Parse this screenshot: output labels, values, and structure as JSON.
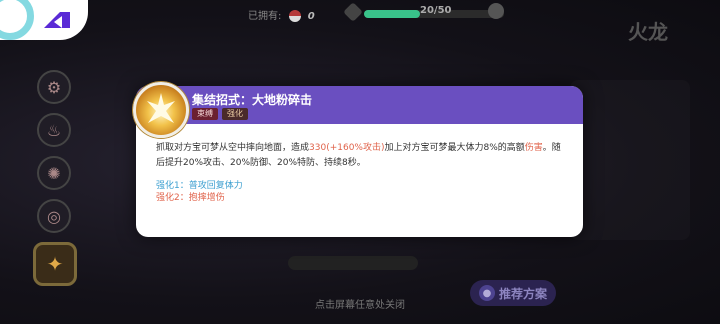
{
  "topbar": {
    "owned_label": "已拥有:",
    "owned_count": "0",
    "xp_text": "20/50",
    "xp_progress": 0.4
  },
  "right_panel": {
    "title": "火龙"
  },
  "dialog": {
    "move_name": "集结招式：大地粉碎击",
    "tags": [
      "束缚",
      "强化"
    ],
    "desc_part1": "抓取对方宝可梦从空中摔向地面，造成",
    "desc_highlight1": "330(+160%攻击)",
    "desc_part2": "加上对方宝可梦最大体力8%的高额",
    "desc_highlight2": "伤害",
    "desc_part3": "。随后提升20%攻击、20%防御、20%特防、持续8秒。",
    "enhance1": "强化1：普攻回复体力",
    "enhance2": "强化2：抱摔增伤"
  },
  "recommend_button": "推荐方案",
  "close_hint": "点击屏幕任意处关闭",
  "colors": {
    "header": "#6a4fc0",
    "highlight": "#e0634b",
    "enhance1": "#3c9fd0",
    "xp": "#39c28a"
  },
  "icons": [
    "settings-icon",
    "fire-icon",
    "spark-icon",
    "vortex-icon",
    "rally-skill-icon",
    "pokeball-icon",
    "arrow-up-icon"
  ]
}
